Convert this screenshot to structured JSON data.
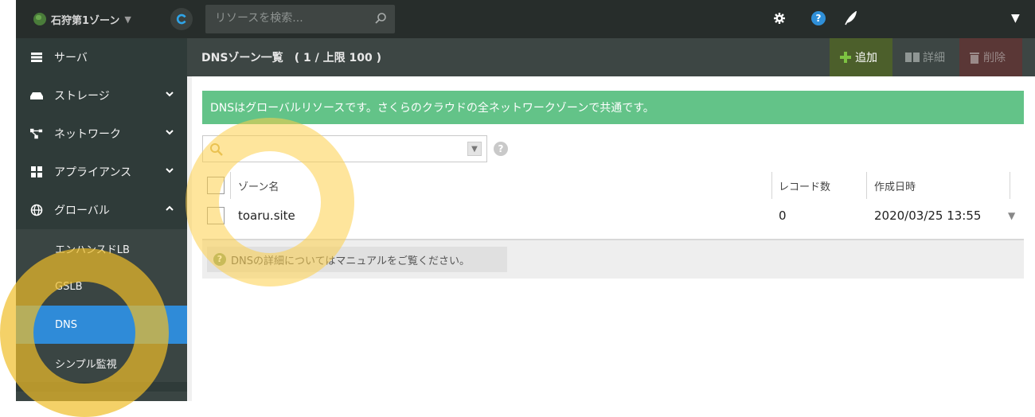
{
  "topbar": {
    "zone_label": "石狩第1ゾーン",
    "search_placeholder": "リソースを検索..."
  },
  "sidebar": {
    "items": [
      {
        "label": "サーバ"
      },
      {
        "label": "ストレージ"
      },
      {
        "label": "ネットワーク"
      },
      {
        "label": "アプライアンス"
      },
      {
        "label": "グローバル"
      }
    ],
    "subitems": [
      {
        "label": "エンハンスドLB"
      },
      {
        "label": "GSLB"
      },
      {
        "label": "DNS"
      },
      {
        "label": "シンプル監視"
      }
    ]
  },
  "main": {
    "title": "DNSゾーン一覧　( 1 / 上限 100 )",
    "buttons": {
      "add": "追加",
      "detail": "詳細",
      "delete": "削除"
    },
    "notice": "DNSはグローバルリソースです。さくらのクラウドの全ネットワークゾーンで共通です。",
    "table": {
      "columns": [
        "ゾーン名",
        "レコード数",
        "作成日時"
      ],
      "rows": [
        {
          "zone": "toaru.site",
          "records": "0",
          "created": "2020/03/25 13:55"
        }
      ]
    },
    "manual_note": "DNSの詳細についてはマニュアルをご覧ください。"
  },
  "colors": {
    "accent": "#2f8bd8",
    "notice": "#63c388",
    "highlight": "#fdcf4a"
  }
}
